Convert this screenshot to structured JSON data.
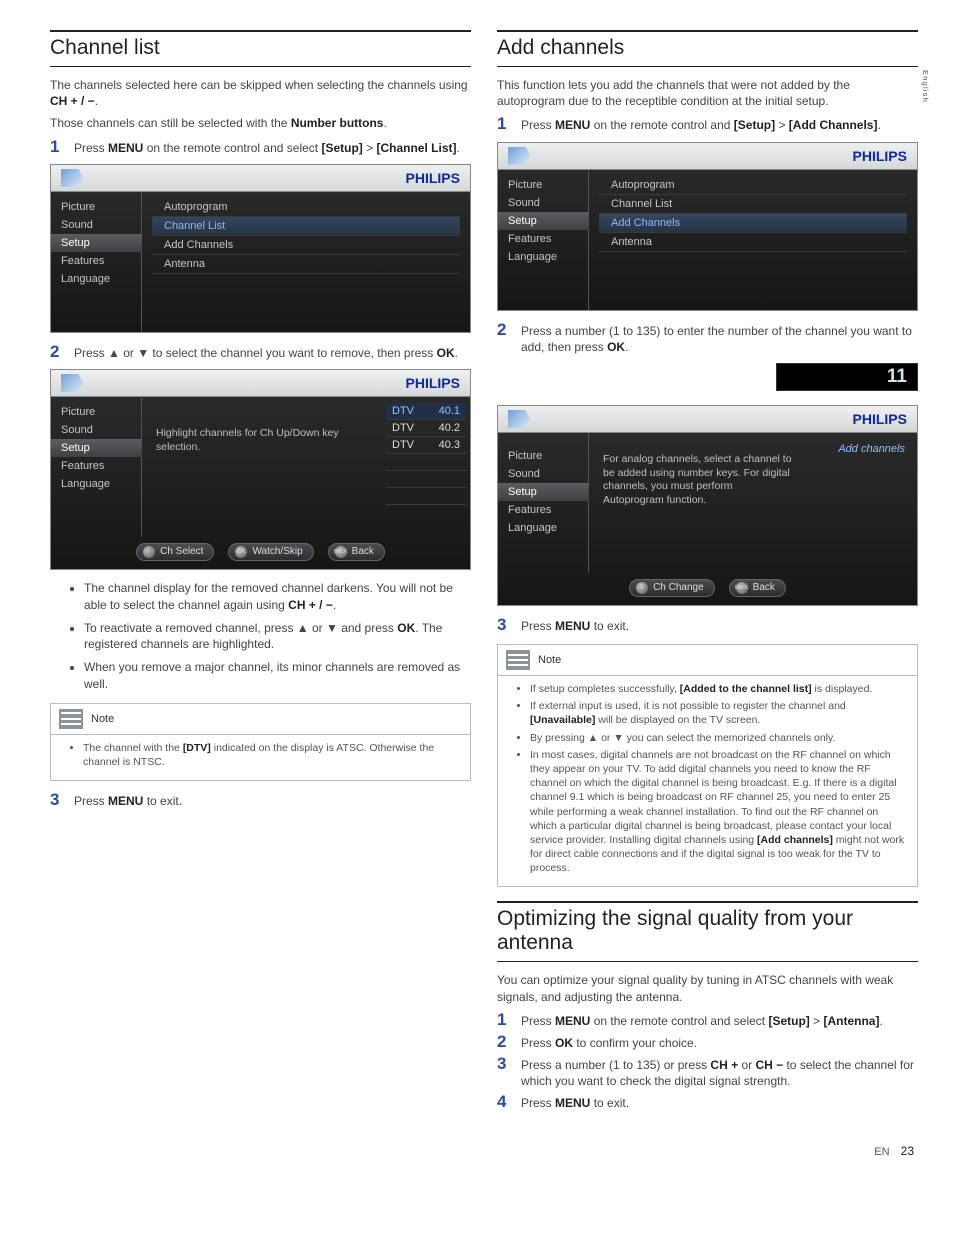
{
  "side_tab": "English",
  "footer": {
    "lang": "EN",
    "page": "23"
  },
  "tv_brand": "PHILIPS",
  "tv_menu": [
    "Picture",
    "Sound",
    "Setup",
    "Features",
    "Language"
  ],
  "tv_menu_sel": "Setup",
  "left": {
    "h1": "Channel list",
    "intro1a": "The channels selected here can be skipped when selecting the channels using ",
    "intro1b": "CH + / −",
    "intro1c": ".",
    "intro2a": "Those channels can still be selected with the ",
    "intro2b": "Number buttons",
    "intro2c": ".",
    "step1": {
      "a": "Press ",
      "b": "MENU",
      "c": " on the remote control and select ",
      "d": "[Setup]",
      "e": " > ",
      "f": "[Channel List]",
      "g": "."
    },
    "tv1_items": [
      "Autoprogram",
      "Channel List",
      "Add Channels",
      "Antenna"
    ],
    "tv1_sel": 1,
    "step2": {
      "a": "Press ▲ or ▼ to select the channel you want to remove, then press ",
      "b": "OK",
      "c": "."
    },
    "tv2_hint": "Highlight channels for Ch Up/Down key selection.",
    "tv2_side": [
      {
        "t": "DTV",
        "v": "40.1"
      },
      {
        "t": "DTV",
        "v": "40.2"
      },
      {
        "t": "DTV",
        "v": "40.3"
      }
    ],
    "tv2_btn1": "Ch Select",
    "tv2_btn2": "Watch/Skip",
    "tv2_btn3": "Back",
    "tv2_btn3_tag": "BACK",
    "bullets": [
      {
        "a": "The channel display for the removed channel darkens. You will not be able to select the channel again using ",
        "b": "CH + / −",
        "c": "."
      },
      {
        "a": "To reactivate a removed channel, press ▲ or ▼ and press ",
        "b": "OK",
        "c": ". The registered channels are highlighted."
      },
      {
        "a": "When you remove a major channel, its minor channels are removed as well.",
        "b": "",
        "c": ""
      }
    ],
    "note_label": "Note",
    "note_items": [
      {
        "a": "The channel with the ",
        "b": "[DTV]",
        "c": " indicated on the display is ATSC. Otherwise the channel is NTSC."
      }
    ],
    "step3": {
      "a": "Press ",
      "b": "MENU",
      "c": " to exit."
    }
  },
  "right": {
    "h1": "Add channels",
    "intro": "This function lets you add the channels that were not added by the autoprogram due to the receptible condition at the initial setup.",
    "step1": {
      "a": "Press ",
      "b": "MENU",
      "c": " on the remote control and ",
      "d": "[Setup]",
      "e": " > ",
      "f": "[Add Channels]",
      "g": "."
    },
    "tv1_items": [
      "Autoprogram",
      "Channel List",
      "Add Channels",
      "Antenna"
    ],
    "tv1_sel": 2,
    "step2": {
      "a": "Press a number (1 to 135) to enter the number of the channel you want to add, then press ",
      "b": "OK",
      "c": "."
    },
    "input_value": "11",
    "tv2_corner": "Add channels",
    "tv2_msg": "For analog channels, select a channel to be added using number keys. For digital channels, you must perform Autoprogram function.",
    "tv2_btn1": "Ch Change",
    "tv2_btn2": "Back",
    "tv2_btn2_tag": "BACK",
    "step3": {
      "a": "Press ",
      "b": "MENU",
      "c": " to exit."
    },
    "note_label": "Note",
    "note_items": [
      {
        "a": "If setup completes successfully, ",
        "b": "[Added to the channel list]",
        "c": " is displayed."
      },
      {
        "a": "If external input is used, it is not possible to register the channel and ",
        "b": "[Unavailable]",
        "c": " will be displayed on the TV screen."
      },
      {
        "a": "By pressing ▲ or ▼ you can select the memorized channels only.",
        "b": "",
        "c": ""
      },
      {
        "a": "In most cases, digital channels are not broadcast on the RF channel on which they appear on your TV. To add digital channels you need to know the RF channel on which the digital channel is being broadcast. E.g. If there is a digital channel 9.1 which is being broadcast on RF channel 25, you need to enter 25 while performing a weak channel installation. To find out the RF channel on which a particular digital channel is being broadcast, please contact your local service provider. Installing digital channels using ",
        "b": "[Add channels]",
        "c": " might not work for direct cable connections and if the digital signal is too weak for the TV to process."
      }
    ],
    "h2": "Optimizing the signal quality from your antenna",
    "opt_intro": "You can optimize your signal quality by tuning in ATSC channels with weak signals, and adjusting the antenna.",
    "opt_steps": [
      {
        "n": "1",
        "a": "Press ",
        "b": "MENU",
        "c": " on the remote control and select ",
        "d": "[Setup]",
        "e": " > ",
        "f": "[Antenna]",
        "g": "."
      },
      {
        "n": "2",
        "a": "Press ",
        "b": "OK",
        "c": " to confirm your choice.",
        "d": "",
        "e": "",
        "f": "",
        "g": ""
      },
      {
        "n": "3",
        "a": "Press a number (1 to 135) or press ",
        "b": "CH +",
        "c": " or ",
        "d": "CH −",
        "e": " to select the channel for which you want to check the digital signal strength.",
        "f": "",
        "g": ""
      },
      {
        "n": "4",
        "a": "Press ",
        "b": "MENU",
        "c": " to exit.",
        "d": "",
        "e": "",
        "f": "",
        "g": ""
      }
    ]
  }
}
